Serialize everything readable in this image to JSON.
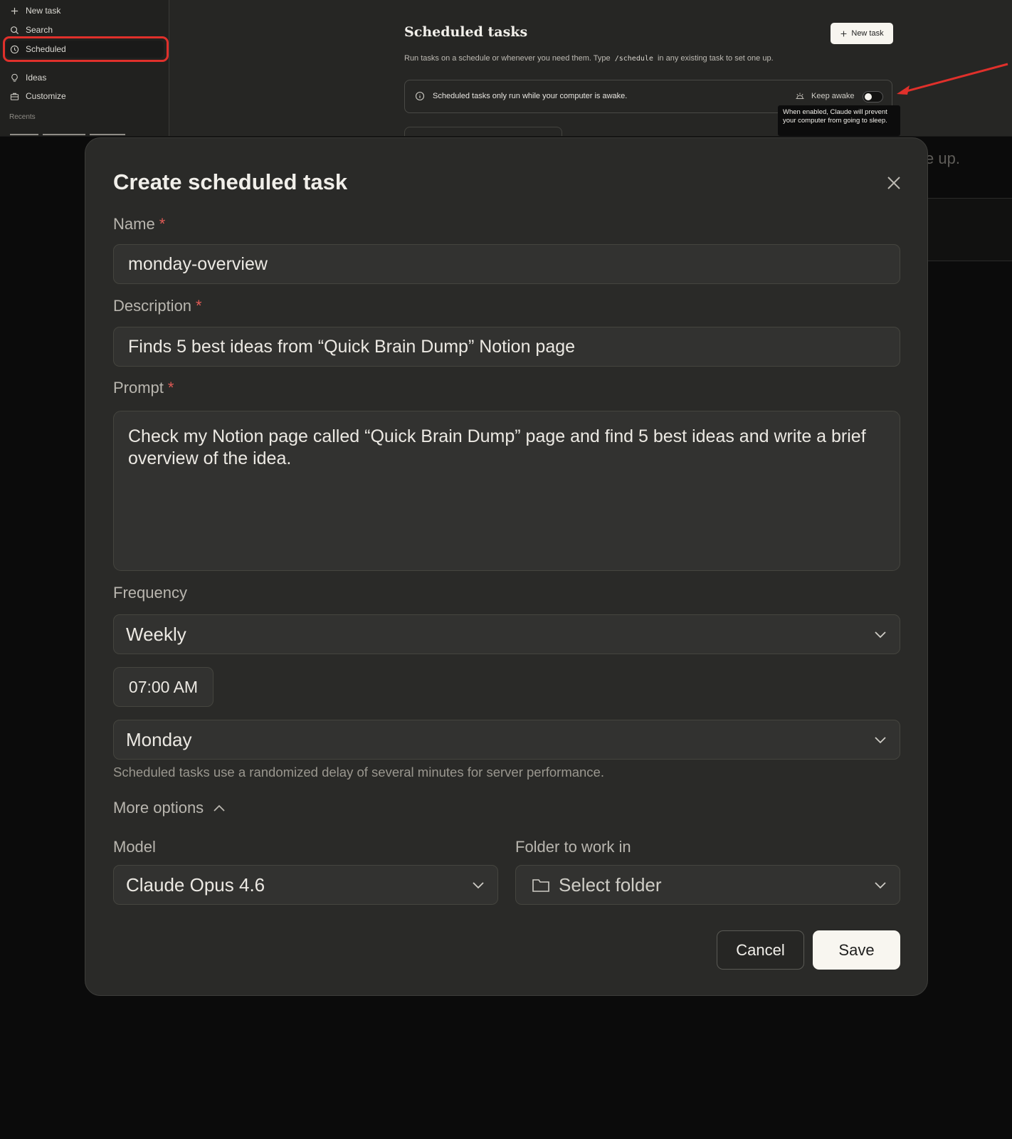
{
  "sidebar": {
    "items": [
      {
        "label": "New task",
        "icon": "plus-icon"
      },
      {
        "label": "Search",
        "icon": "search-icon"
      },
      {
        "label": "Scheduled",
        "icon": "clock-icon",
        "active": true
      },
      {
        "label": "Ideas",
        "icon": "lightbulb-icon"
      },
      {
        "label": "Customize",
        "icon": "briefcase-icon"
      }
    ],
    "recents_label": "Recents"
  },
  "page": {
    "title": "Scheduled tasks",
    "new_task_label": "New task",
    "subtitle_pre": "Run tasks on a schedule or whenever you need them. Type",
    "subtitle_code": "/schedule",
    "subtitle_post": "in any existing task to set one up.",
    "notice": "Scheduled tasks only run while your computer is awake.",
    "keep_awake_label": "Keep awake",
    "keep_awake_on": false,
    "tooltip": "When enabled, Claude will prevent your computer from going to sleep.",
    "bg_text": "e up."
  },
  "modal": {
    "title": "Create scheduled task",
    "name_label": "Name",
    "name_value": "monday-overview",
    "description_label": "Description",
    "description_value": "Finds 5 best ideas from “Quick Brain Dump” Notion page",
    "prompt_label": "Prompt",
    "prompt_value": "Check my Notion page called “Quick Brain Dump” page and find 5 best ideas and write a brief overview of the idea.",
    "required_mark": "*",
    "frequency_label": "Frequency",
    "frequency_value": "Weekly",
    "time_value": "07:00 AM",
    "day_value": "Monday",
    "hint": "Scheduled tasks use a randomized delay of several minutes for server performance.",
    "more_options_label": "More options",
    "model_label": "Model",
    "model_value": "Claude Opus 4.6",
    "folder_label": "Folder to work in",
    "folder_value": "Select folder",
    "cancel_label": "Cancel",
    "save_label": "Save"
  },
  "colors": {
    "accent_highlight": "#e0302b",
    "required": "#e05a55"
  }
}
